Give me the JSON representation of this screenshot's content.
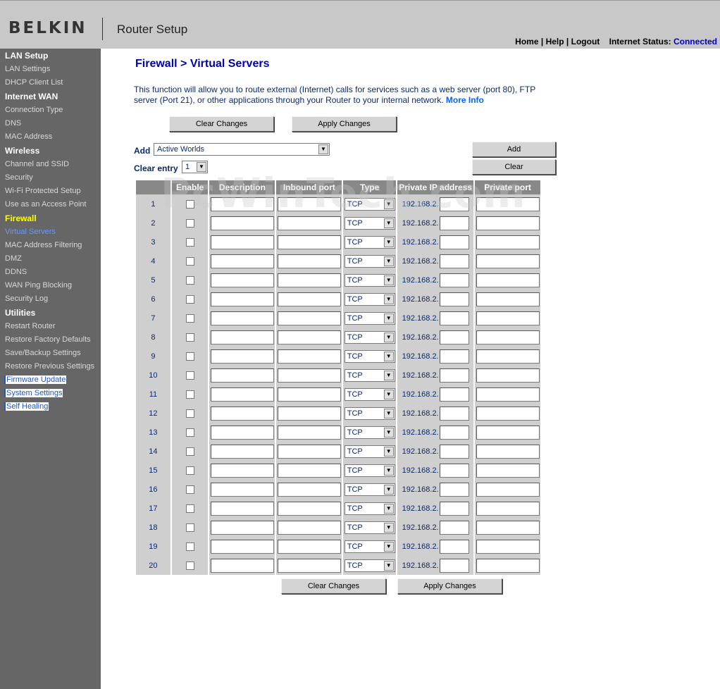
{
  "header": {
    "logo": "BELKIN",
    "app_title": "Router Setup",
    "links": {
      "home": "Home",
      "help": "Help",
      "logout": "Logout",
      "separator": "|"
    },
    "status_label": "Internet Status:",
    "status_value": "Connected",
    "status_color": "#0000cc"
  },
  "sidebar": {
    "lan_setup": "LAN Setup",
    "lan_settings": "LAN Settings",
    "dhcp_client_list": "DHCP Client List",
    "internet_wan": "Internet WAN",
    "connection_type": "Connection Type",
    "dns": "DNS",
    "mac_address": "MAC Address",
    "wireless": "Wireless",
    "channel_ssid": "Channel and SSID",
    "security": "Security",
    "wifi_protected_setup": "Wi-Fi Protected Setup",
    "access_point": "Use as an Access Point",
    "firewall": "Firewall",
    "virtual_servers": "Virtual Servers",
    "mac_filtering": "MAC Address Filtering",
    "dmz": "DMZ",
    "ddns": "DDNS",
    "wan_ping_blocking": "WAN Ping Blocking",
    "security_log": "Security Log",
    "utilities": "Utilities",
    "restart_router": "Restart Router",
    "restore_defaults": "Restore Factory Defaults",
    "save_backup": "Save/Backup Settings",
    "restore_previous": "Restore Previous Settings",
    "firmware_update": "Firmware Update",
    "system_settings": "System Settings",
    "self_healing": "Self Healing"
  },
  "main": {
    "title": "Firewall > Virtual Servers",
    "intro": "This function will allow you to route external (Internet) calls for services such as a web server (port 80), FTP server (Port 21), or other applications through your Router to your internal network.",
    "more_info": "More Info",
    "clear_changes": "Clear Changes",
    "apply_changes": "Apply Changes",
    "add_label": "Add",
    "add_selected": "Active Worlds",
    "add_button": "Add",
    "clear_entry_label": "Clear entry",
    "clear_entry_selected": "1",
    "clear_button": "Clear"
  },
  "table": {
    "headers": [
      "",
      "Enable",
      "Description",
      "Inbound port",
      "Type",
      "Private IP address",
      "Private port"
    ],
    "type_default": "TCP",
    "ip_prefix": "192.168.2.",
    "rows": [
      "1",
      "2",
      "3",
      "4",
      "5",
      "6",
      "7",
      "8",
      "9",
      "10",
      "11",
      "12",
      "13",
      "14",
      "15",
      "16",
      "17",
      "18",
      "19",
      "20"
    ]
  },
  "watermark": "PcWinTech.com"
}
